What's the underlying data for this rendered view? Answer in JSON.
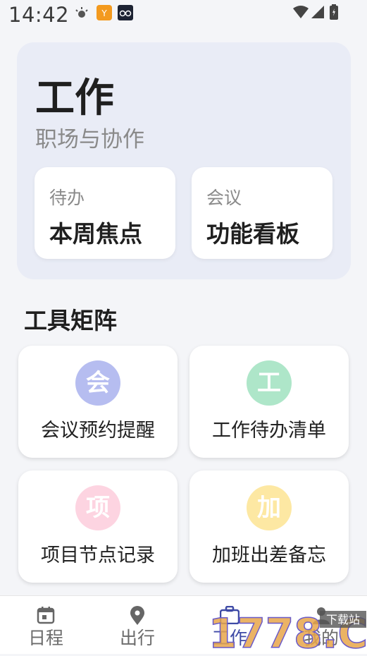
{
  "status_bar": {
    "time": "14:42",
    "icons": [
      "brightness-icon",
      "app-notification-icon",
      "glasses-icon",
      "wifi-icon",
      "signal-icon",
      "battery-icon"
    ]
  },
  "hero": {
    "title": "工作",
    "subtitle": "职场与协作",
    "cards": [
      {
        "tag": "待办",
        "title": "本周焦点"
      },
      {
        "tag": "会议",
        "title": "功能看板"
      }
    ]
  },
  "tools": {
    "section_title": "工具矩阵",
    "items": [
      {
        "badge": "会",
        "label": "会议预约提醒",
        "color": "#b6bdf0"
      },
      {
        "badge": "工",
        "label": "工作待办清单",
        "color": "#aee6c9"
      },
      {
        "badge": "项",
        "label": "项目节点记录",
        "color": "#fdd4e1"
      },
      {
        "badge": "加",
        "label": "加班出差备忘",
        "color": "#fde8a3"
      }
    ]
  },
  "tabbar": {
    "items": [
      {
        "label": "日程",
        "icon": "calendar-icon"
      },
      {
        "label": "出行",
        "icon": "location-pin-icon"
      },
      {
        "label": "工作",
        "icon": "briefcase-icon",
        "active": true
      },
      {
        "label": "我的",
        "icon": "person-icon"
      }
    ],
    "active_color": "#3e4aa6"
  },
  "watermark": {
    "text": "1778.COM",
    "caption": "下载站"
  }
}
